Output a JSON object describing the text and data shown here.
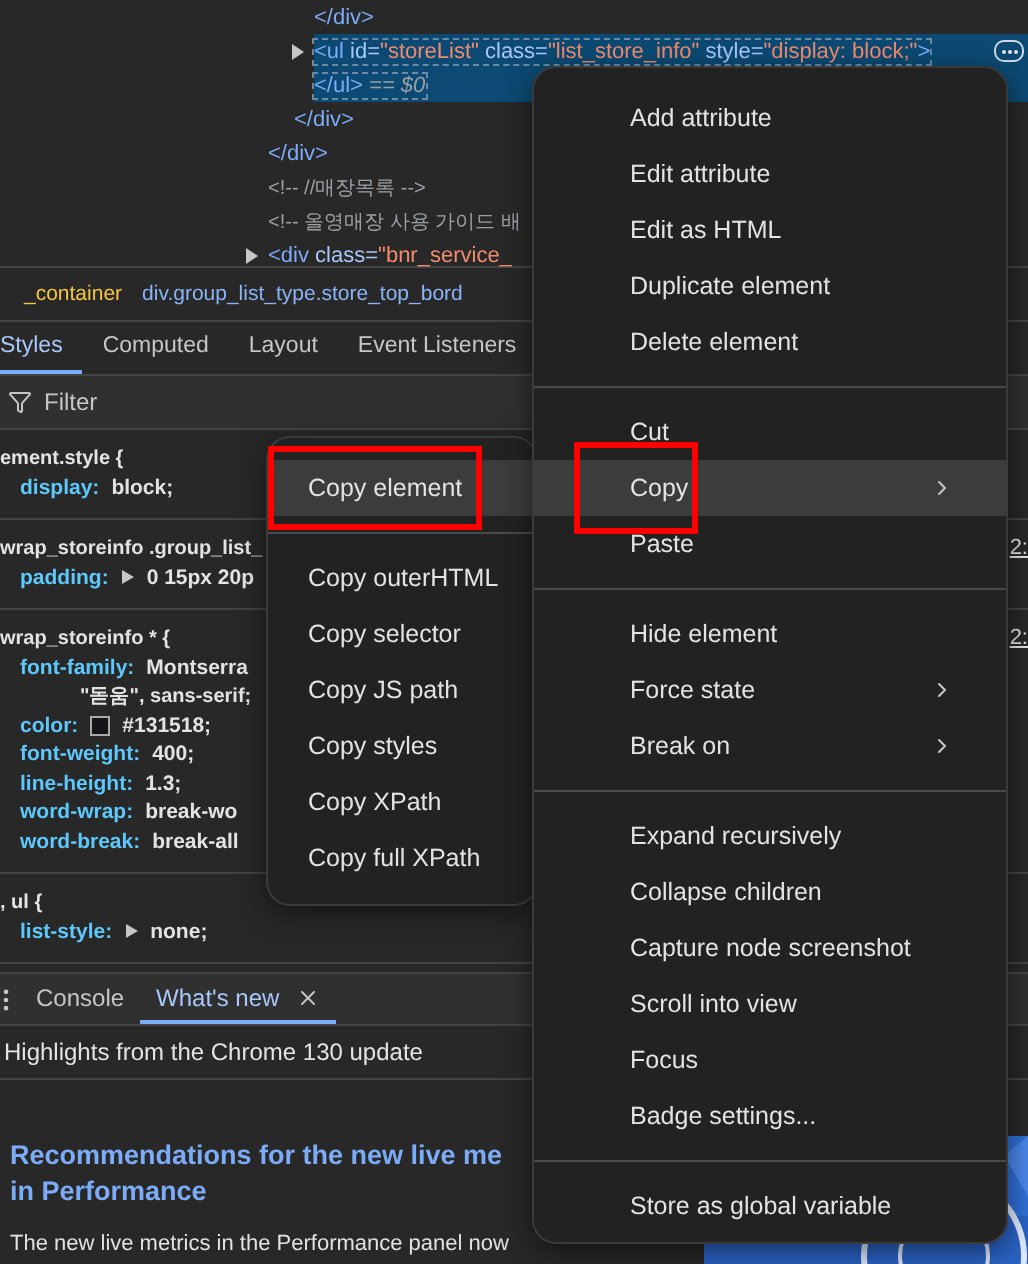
{
  "elements": {
    "tree": [
      {
        "children": [
          {
            "children": [
              {
                "selected": false,
                "tokens": [
                  {
                    "kind": "tag",
                    "text": "</div>"
                  }
                ]
              },
              {
                "selected": true,
                "expanded": false,
                "has_more": true,
                "tokens": [
                  {
                    "kind": "tag",
                    "text": "<ul"
                  },
                  {
                    "kind": "attr",
                    "text": " id="
                  },
                  {
                    "kind": "value",
                    "text": "\"storeList\""
                  },
                  {
                    "kind": "attr",
                    "text": " class="
                  },
                  {
                    "kind": "value",
                    "text": "\"list_store_info\""
                  },
                  {
                    "kind": "attr",
                    "text": " style="
                  },
                  {
                    "kind": "value",
                    "text": "\"display: block;\""
                  },
                  {
                    "kind": "tag",
                    "text": ">"
                  }
                ]
              },
              {
                "selected": true,
                "tokens": [
                  {
                    "kind": "tag",
                    "text": "</ul>"
                  },
                  {
                    "kind": "var",
                    "text": " == $0"
                  }
                ]
              }
            ]
          },
          {
            "selected": false,
            "tokens": [
              {
                "kind": "tag",
                "text": "</div>"
              }
            ]
          }
        ]
      },
      {
        "selected": false,
        "tokens": [
          {
            "kind": "tag",
            "text": "</div>"
          }
        ]
      },
      {
        "selected": false,
        "tokens": [
          {
            "kind": "comment",
            "text": "<!-- //매장목록 -->"
          }
        ]
      },
      {
        "selected": false,
        "tokens": [
          {
            "kind": "comment",
            "text": "<!-- 올영매장 사용 가이드 배"
          }
        ]
      },
      {
        "selected": false,
        "expanded": false,
        "tokens": [
          {
            "kind": "tag",
            "text": "<div"
          },
          {
            "kind": "attr",
            "text": " class="
          },
          {
            "kind": "value",
            "text": "\"bnr_service_"
          }
        ]
      }
    ]
  },
  "breadcrumbs": [
    {
      "label": "_container",
      "color": "#f6c543"
    },
    {
      "label": "div.group_list_type.store_top_bord",
      "color": "#8ab4f8"
    }
  ],
  "style_tabs": [
    {
      "label": "Styles",
      "selected": true
    },
    {
      "label": "Computed",
      "selected": false
    },
    {
      "label": "Layout",
      "selected": false
    },
    {
      "label": "Event Listeners",
      "selected": false
    }
  ],
  "filter": {
    "placeholder": "Filter"
  },
  "rules": [
    {
      "selector": "ement.style {",
      "properties": [
        {
          "name": "display:",
          "value": "block;"
        }
      ]
    },
    {
      "selector": "wrap_storeinfo .group_list_",
      "source": "2:",
      "properties": [
        {
          "name": "padding:",
          "value": "0 15px 20p",
          "expandable": true
        }
      ]
    },
    {
      "selector": "wrap_storeinfo * {",
      "source": "2:",
      "properties": [
        {
          "name": "font-family:",
          "value": "Montserra",
          "continuation": "\"돋움\", sans-serif;"
        },
        {
          "name": "color:",
          "value": "#131518;",
          "color": "#131518"
        },
        {
          "name": "font-weight:",
          "value": "400;"
        },
        {
          "name": "line-height:",
          "value": "1.3;"
        },
        {
          "name": "word-wrap:",
          "value": "break-wo"
        },
        {
          "name": "word-break:",
          "value": "break-all"
        }
      ]
    },
    {
      "selector": ", ul {",
      "properties": [
        {
          "name": "list-style:",
          "value": "none;",
          "expandable": true
        }
      ]
    }
  ],
  "drawer": {
    "tabs": [
      {
        "label": "Console",
        "selected": false
      },
      {
        "label": "What's new",
        "selected": true,
        "closable": true
      }
    ],
    "highlights": "Highlights from the Chrome 130 update",
    "heading": [
      "Recommendations for the new live me",
      "in Performance"
    ],
    "paragraph": "The new live metrics in the Performance panel now"
  },
  "context_menu": {
    "groups": [
      [
        {
          "label": "Add attribute",
          "highlighted": false
        },
        {
          "label": "Edit attribute",
          "highlighted": false
        },
        {
          "label": "Edit as HTML",
          "highlighted": false
        },
        {
          "label": "Duplicate element",
          "highlighted": false
        },
        {
          "label": "Delete element",
          "highlighted": false
        }
      ],
      [
        {
          "label": "Cut",
          "highlighted": false
        },
        {
          "label": "Copy",
          "highlighted": true,
          "submenu": true,
          "outlined": true
        },
        {
          "label": "Paste",
          "highlighted": false
        }
      ],
      [
        {
          "label": "Hide element",
          "highlighted": false
        },
        {
          "label": "Force state",
          "highlighted": false,
          "submenu": true
        },
        {
          "label": "Break on",
          "highlighted": false,
          "submenu": true
        }
      ],
      [
        {
          "label": "Expand recursively",
          "highlighted": false
        },
        {
          "label": "Collapse children",
          "highlighted": false
        },
        {
          "label": "Capture node screenshot",
          "highlighted": false
        },
        {
          "label": "Scroll into view",
          "highlighted": false
        },
        {
          "label": "Focus",
          "highlighted": false
        },
        {
          "label": "Badge settings...",
          "highlighted": false
        }
      ],
      [
        {
          "label": "Store as global variable",
          "highlighted": false
        }
      ]
    ]
  },
  "copy_submenu": {
    "groups": [
      [
        {
          "label": "Copy element",
          "highlighted": true,
          "outlined": true
        }
      ],
      [
        {
          "label": "Copy outerHTML",
          "highlighted": false
        },
        {
          "label": "Copy selector",
          "highlighted": false
        },
        {
          "label": "Copy JS path",
          "highlighted": false
        },
        {
          "label": "Copy styles",
          "highlighted": false
        },
        {
          "label": "Copy XPath",
          "highlighted": false
        },
        {
          "label": "Copy full XPath",
          "highlighted": false
        }
      ]
    ]
  }
}
